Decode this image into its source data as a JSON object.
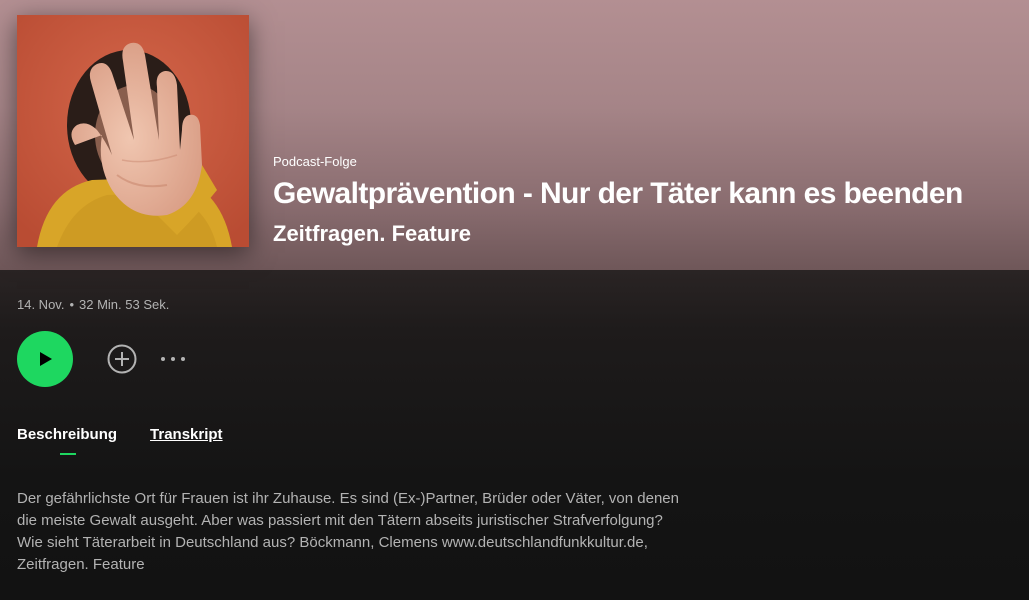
{
  "episode": {
    "kind_label": "Podcast-Folge",
    "title": "Gewaltprävention - Nur der Täter kann es beenden",
    "show": "Zeitfragen. Feature",
    "cover_icon": "cover-art-hand-stop"
  },
  "meta": {
    "date": "14. Nov.",
    "separator": "•",
    "duration": "32 Min. 53 Sek."
  },
  "controls": {
    "play_icon": "play-icon",
    "add_icon": "plus-circle-icon",
    "more_icon": "more-dots-icon",
    "accent_color": "#1ed760"
  },
  "tabs": [
    {
      "label": "Beschreibung",
      "active": true
    },
    {
      "label": "Transkript",
      "active": false
    }
  ],
  "description": "Der gefährlichste Ort für Frauen ist ihr Zuhause. Es sind (Ex-)Partner, Brüder oder Väter, von denen die meiste Gewalt ausgeht. Aber was passiert mit den Tätern abseits juristischer Strafverfolgung? Wie sieht Täterarbeit in Deutschland aus? Böckmann, Clemens www.deutschlandfunkkultur.de, Zeitfragen. Feature"
}
